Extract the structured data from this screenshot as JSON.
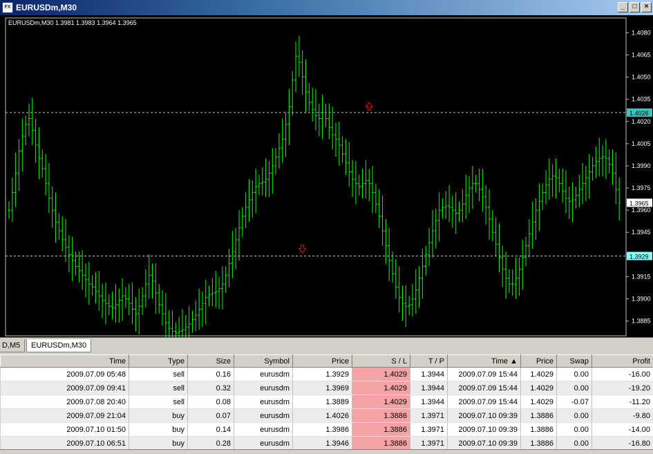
{
  "window": {
    "title": "EURUSDm,M30",
    "icon": "chart-app-icon"
  },
  "chart": {
    "legend": "EURUSDm,M30  1.3981 1.3983 1.3964 1.3965",
    "colors": {
      "background": "#000000",
      "bars": "#00ff00",
      "grid": "#c0c0c0",
      "arrow": "#ff0000"
    },
    "current_price": "1.3965",
    "marked_levels": [
      "1.4026",
      "1.3929"
    ]
  },
  "chart_data": {
    "type": "ohlc",
    "title": "EURUSDm,M30",
    "xlabel": "",
    "ylabel": "",
    "ylim": [
      1.3875,
      1.409
    ],
    "y_ticks": [
      "1.4080",
      "1.4065",
      "1.4050",
      "1.4035",
      "1.4020",
      "1.4005",
      "1.3990",
      "1.3975",
      "1.3960",
      "1.3945",
      "1.3930",
      "1.3915",
      "1.3900",
      "1.3885"
    ],
    "tick_values": [
      1.408,
      1.4065,
      1.405,
      1.4035,
      1.402,
      1.4005,
      1.399,
      1.3975,
      1.396,
      1.3945,
      1.393,
      1.3915,
      1.39,
      1.3885
    ],
    "hlines": [
      1.4026,
      1.3929
    ],
    "arrows": [
      {
        "dir": "up",
        "price": 1.403,
        "bar": 108
      },
      {
        "dir": "down",
        "price": 1.3934,
        "bar": 88
      }
    ],
    "closes": [
      1.396,
      1.3972,
      1.3985,
      1.4,
      1.401,
      1.4018,
      1.4022,
      1.4014,
      1.4004,
      1.3995,
      1.3988,
      1.3978,
      1.3968,
      1.396,
      1.3952,
      1.3946,
      1.394,
      1.3935,
      1.393,
      1.3926,
      1.3922,
      1.3919,
      1.3916,
      1.3913,
      1.391,
      1.3908,
      1.3905,
      1.3902,
      1.3899,
      1.3897,
      1.3895,
      1.3894,
      1.3896,
      1.3899,
      1.3902,
      1.39,
      1.3897,
      1.3893,
      1.389,
      1.3895,
      1.3902,
      1.391,
      1.3916,
      1.3912,
      1.3904,
      1.3896,
      1.389,
      1.3884,
      1.388,
      1.3878,
      1.3877,
      1.3878,
      1.3879,
      1.3881,
      1.3883,
      1.3886,
      1.3889,
      1.3893,
      1.3897,
      1.3901,
      1.3903,
      1.3904,
      1.3905,
      1.3907,
      1.391,
      1.3916,
      1.3924,
      1.3932,
      1.394,
      1.3948,
      1.3956,
      1.3962,
      1.3967,
      1.3972,
      1.3976,
      1.3978,
      1.3979,
      1.3981,
      1.3985,
      1.399,
      1.3996,
      1.4002,
      1.4008,
      1.4018,
      1.403,
      1.4048,
      1.4064,
      1.406,
      1.405,
      1.404,
      1.4033,
      1.4028,
      1.4024,
      1.4022,
      1.4026,
      1.4022,
      1.4016,
      1.4011,
      1.4008,
      1.4004,
      1.3998,
      1.3992,
      1.3986,
      1.3981,
      1.3978,
      1.3976,
      1.3978,
      1.398,
      1.3978,
      1.3972,
      1.3964,
      1.3956,
      1.3946,
      1.3936,
      1.3926,
      1.3917,
      1.3908,
      1.3901,
      1.3897,
      1.3895,
      1.3896,
      1.39,
      1.3906,
      1.3914,
      1.3922,
      1.393,
      1.3938,
      1.3946,
      1.3953,
      1.396,
      1.3962,
      1.3963,
      1.3962,
      1.396,
      1.3958,
      1.396,
      1.3964,
      1.397,
      1.3975,
      1.3978,
      1.3978,
      1.3974,
      1.3969,
      1.3962,
      1.3954,
      1.3945,
      1.3937,
      1.3928,
      1.392,
      1.3914,
      1.391,
      1.391,
      1.3914,
      1.392,
      1.3928,
      1.3936,
      1.3944,
      1.3952,
      1.396,
      1.3966,
      1.3972,
      1.3977,
      1.3981,
      1.3983,
      1.3982,
      1.3978,
      1.3973,
      1.3968,
      1.3966,
      1.3967,
      1.397,
      1.3974,
      1.3978,
      1.3982,
      1.3986,
      1.399,
      1.3993,
      1.3995,
      1.3996,
      1.3995,
      1.3991,
      1.3985,
      1.3974,
      1.3965
    ]
  },
  "tabs": [
    {
      "label": "D,M5"
    },
    {
      "label": "EURUSDm,M30",
      "active": true
    }
  ],
  "table": {
    "columns": [
      "Time",
      "Type",
      "Size",
      "Symbol",
      "Price",
      "S / L",
      "T / P",
      "Time",
      "Price",
      "Swap",
      "Profit"
    ],
    "sort_indicator": "▲",
    "rows": [
      [
        "2009.07.09 05:48",
        "sell",
        "0.16",
        "eurusdm",
        "1.3929",
        "1.4029",
        "1.3944",
        "2009.07.09 15:44",
        "1.4029",
        "0.00",
        "-16.00"
      ],
      [
        "2009.07.09 09:41",
        "sell",
        "0.32",
        "eurusdm",
        "1.3969",
        "1.4029",
        "1.3944",
        "2009.07.09 15:44",
        "1.4029",
        "0.00",
        "-19.20"
      ],
      [
        "2009.07.08 20:40",
        "sell",
        "0.08",
        "eurusdm",
        "1.3889",
        "1.4029",
        "1.3944",
        "2009.07.09 15:44",
        "1.4029",
        "-0.07",
        "-11.20"
      ],
      [
        "2009.07.09 21:04",
        "buy",
        "0.07",
        "eurusdm",
        "1.4026",
        "1.3886",
        "1.3971",
        "2009.07.10 09:39",
        "1.3886",
        "0.00",
        "-9.80"
      ],
      [
        "2009.07.10 01:50",
        "buy",
        "0.14",
        "eurusdm",
        "1.3986",
        "1.3886",
        "1.3971",
        "2009.07.10 09:39",
        "1.3886",
        "0.00",
        "-14.00"
      ],
      [
        "2009.07.10 06:51",
        "buy",
        "0.28",
        "eurusdm",
        "1.3946",
        "1.3886",
        "1.3971",
        "2009.07.10 09:39",
        "1.3886",
        "0.00",
        "-16.80"
      ]
    ]
  }
}
